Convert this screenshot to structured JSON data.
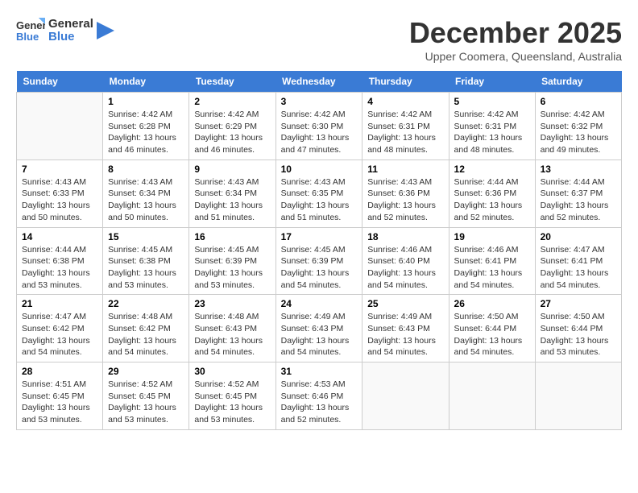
{
  "header": {
    "logo_general": "General",
    "logo_blue": "Blue",
    "month_title": "December 2025",
    "location": "Upper Coomera, Queensland, Australia"
  },
  "weekdays": [
    "Sunday",
    "Monday",
    "Tuesday",
    "Wednesday",
    "Thursday",
    "Friday",
    "Saturday"
  ],
  "weeks": [
    [
      {
        "day": "",
        "info": ""
      },
      {
        "day": "1",
        "sunrise": "4:42 AM",
        "sunset": "6:28 PM",
        "daylight": "13 hours and 46 minutes."
      },
      {
        "day": "2",
        "sunrise": "4:42 AM",
        "sunset": "6:29 PM",
        "daylight": "13 hours and 46 minutes."
      },
      {
        "day": "3",
        "sunrise": "4:42 AM",
        "sunset": "6:30 PM",
        "daylight": "13 hours and 47 minutes."
      },
      {
        "day": "4",
        "sunrise": "4:42 AM",
        "sunset": "6:31 PM",
        "daylight": "13 hours and 48 minutes."
      },
      {
        "day": "5",
        "sunrise": "4:42 AM",
        "sunset": "6:31 PM",
        "daylight": "13 hours and 48 minutes."
      },
      {
        "day": "6",
        "sunrise": "4:42 AM",
        "sunset": "6:32 PM",
        "daylight": "13 hours and 49 minutes."
      }
    ],
    [
      {
        "day": "7",
        "sunrise": "4:43 AM",
        "sunset": "6:33 PM",
        "daylight": "13 hours and 50 minutes."
      },
      {
        "day": "8",
        "sunrise": "4:43 AM",
        "sunset": "6:34 PM",
        "daylight": "13 hours and 50 minutes."
      },
      {
        "day": "9",
        "sunrise": "4:43 AM",
        "sunset": "6:34 PM",
        "daylight": "13 hours and 51 minutes."
      },
      {
        "day": "10",
        "sunrise": "4:43 AM",
        "sunset": "6:35 PM",
        "daylight": "13 hours and 51 minutes."
      },
      {
        "day": "11",
        "sunrise": "4:43 AM",
        "sunset": "6:36 PM",
        "daylight": "13 hours and 52 minutes."
      },
      {
        "day": "12",
        "sunrise": "4:44 AM",
        "sunset": "6:36 PM",
        "daylight": "13 hours and 52 minutes."
      },
      {
        "day": "13",
        "sunrise": "4:44 AM",
        "sunset": "6:37 PM",
        "daylight": "13 hours and 52 minutes."
      }
    ],
    [
      {
        "day": "14",
        "sunrise": "4:44 AM",
        "sunset": "6:38 PM",
        "daylight": "13 hours and 53 minutes."
      },
      {
        "day": "15",
        "sunrise": "4:45 AM",
        "sunset": "6:38 PM",
        "daylight": "13 hours and 53 minutes."
      },
      {
        "day": "16",
        "sunrise": "4:45 AM",
        "sunset": "6:39 PM",
        "daylight": "13 hours and 53 minutes."
      },
      {
        "day": "17",
        "sunrise": "4:45 AM",
        "sunset": "6:39 PM",
        "daylight": "13 hours and 54 minutes."
      },
      {
        "day": "18",
        "sunrise": "4:46 AM",
        "sunset": "6:40 PM",
        "daylight": "13 hours and 54 minutes."
      },
      {
        "day": "19",
        "sunrise": "4:46 AM",
        "sunset": "6:41 PM",
        "daylight": "13 hours and 54 minutes."
      },
      {
        "day": "20",
        "sunrise": "4:47 AM",
        "sunset": "6:41 PM",
        "daylight": "13 hours and 54 minutes."
      }
    ],
    [
      {
        "day": "21",
        "sunrise": "4:47 AM",
        "sunset": "6:42 PM",
        "daylight": "13 hours and 54 minutes."
      },
      {
        "day": "22",
        "sunrise": "4:48 AM",
        "sunset": "6:42 PM",
        "daylight": "13 hours and 54 minutes."
      },
      {
        "day": "23",
        "sunrise": "4:48 AM",
        "sunset": "6:43 PM",
        "daylight": "13 hours and 54 minutes."
      },
      {
        "day": "24",
        "sunrise": "4:49 AM",
        "sunset": "6:43 PM",
        "daylight": "13 hours and 54 minutes."
      },
      {
        "day": "25",
        "sunrise": "4:49 AM",
        "sunset": "6:43 PM",
        "daylight": "13 hours and 54 minutes."
      },
      {
        "day": "26",
        "sunrise": "4:50 AM",
        "sunset": "6:44 PM",
        "daylight": "13 hours and 54 minutes."
      },
      {
        "day": "27",
        "sunrise": "4:50 AM",
        "sunset": "6:44 PM",
        "daylight": "13 hours and 53 minutes."
      }
    ],
    [
      {
        "day": "28",
        "sunrise": "4:51 AM",
        "sunset": "6:45 PM",
        "daylight": "13 hours and 53 minutes."
      },
      {
        "day": "29",
        "sunrise": "4:52 AM",
        "sunset": "6:45 PM",
        "daylight": "13 hours and 53 minutes."
      },
      {
        "day": "30",
        "sunrise": "4:52 AM",
        "sunset": "6:45 PM",
        "daylight": "13 hours and 53 minutes."
      },
      {
        "day": "31",
        "sunrise": "4:53 AM",
        "sunset": "6:46 PM",
        "daylight": "13 hours and 52 minutes."
      },
      {
        "day": "",
        "info": ""
      },
      {
        "day": "",
        "info": ""
      },
      {
        "day": "",
        "info": ""
      }
    ]
  ]
}
